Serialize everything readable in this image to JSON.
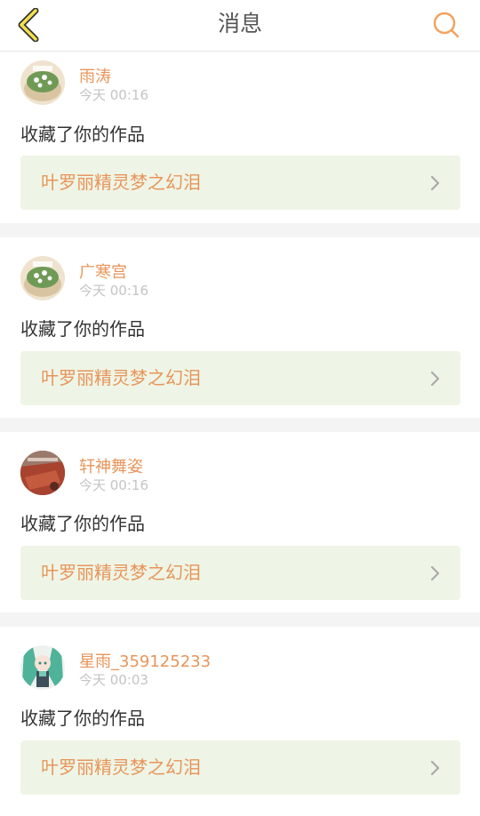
{
  "header": {
    "title": "消息",
    "back_icon": "chevron-left-icon",
    "search_icon": "search-icon",
    "accent_color": "#f2a35f"
  },
  "messages": [
    {
      "username": "雨涛",
      "time": "今天 00:16",
      "action": "收藏了你的作品",
      "work_title": "叶罗丽精灵梦之幻泪",
      "avatar_style": "flower-cake"
    },
    {
      "username": "广寒宫",
      "time": "今天 00:16",
      "action": "收藏了你的作品",
      "work_title": "叶罗丽精灵梦之幻泪",
      "avatar_style": "flower-cake"
    },
    {
      "username": "轩神舞姿",
      "time": "今天 00:16",
      "action": "收藏了你的作品",
      "work_title": "叶罗丽精灵梦之幻泪",
      "avatar_style": "red-scene"
    },
    {
      "username": "星雨_359125233",
      "time": "今天 00:03",
      "action": "收藏了你的作品",
      "work_title": "叶罗丽精灵梦之幻泪",
      "avatar_style": "anime-green-hair"
    }
  ]
}
